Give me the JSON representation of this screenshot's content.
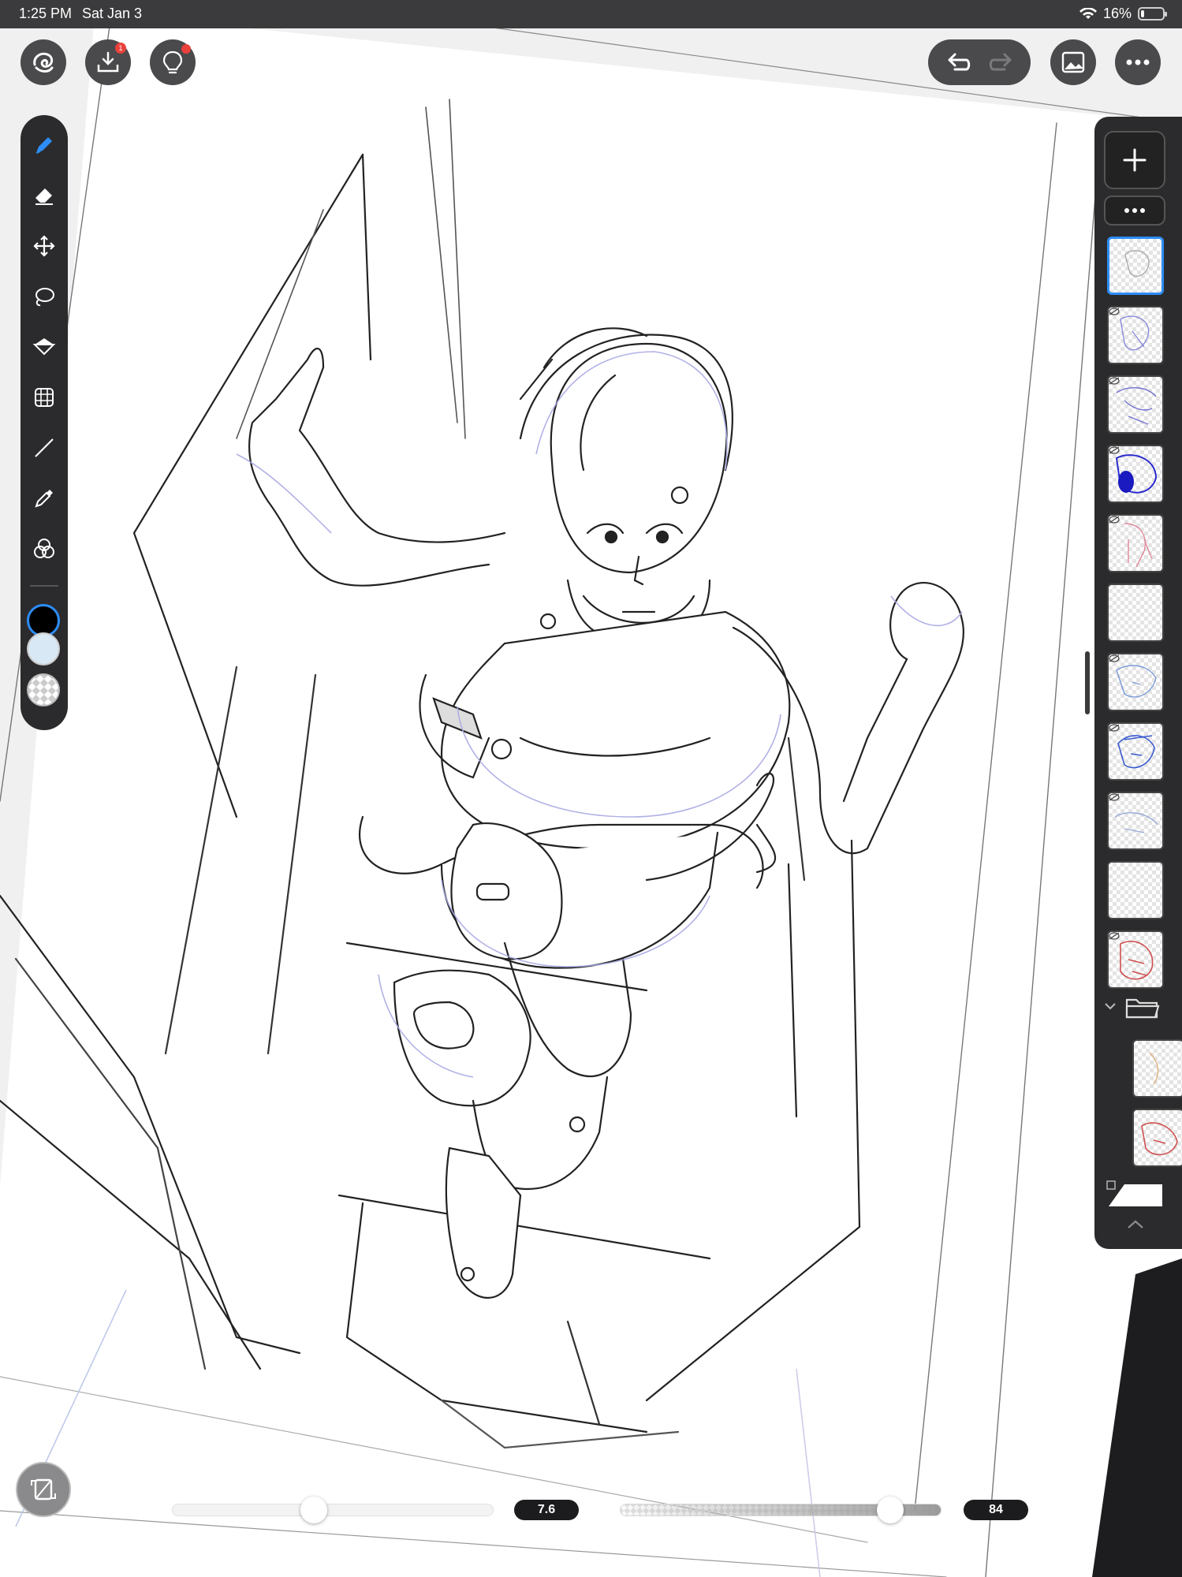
{
  "status_bar": {
    "time": "1:25 PM",
    "date": "Sat Jan 3",
    "battery": "16%",
    "battery_level": 0.16
  },
  "top_bar": {
    "gallery_icon": "spiral-logo-icon",
    "import_icon": "import-tray-icon",
    "import_badge": "1",
    "tips_icon": "lightbulb-icon",
    "undo_icon": "undo-icon",
    "redo_icon": "redo-icon",
    "reference_icon": "image-icon",
    "more_icon": "ellipsis-icon"
  },
  "toolbar": {
    "tools": [
      "pen",
      "eraser",
      "move",
      "lasso",
      "fill",
      "grid-transform",
      "line",
      "eyedropper",
      "color-blend"
    ],
    "active_tool": "pen",
    "primary_color": "#000000",
    "secondary_color": "#d8e8f4",
    "third_color": "transparent"
  },
  "layers": {
    "count_visible": 13,
    "selected_index": 0
  },
  "bottom": {
    "brush_size_label": "7.6",
    "brush_size_level": 0.44,
    "opacity_label": "84",
    "opacity_level": 0.84
  },
  "colors": {
    "accent": "#2d8df5",
    "panel": "#2b2b2d",
    "button": "#4a4a4c"
  }
}
